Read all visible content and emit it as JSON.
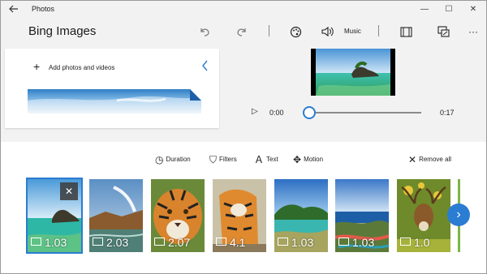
{
  "titlebar": {
    "app_title": "Photos",
    "back_icon": "arrow-left-icon",
    "minimize": "—",
    "maximize": "☐",
    "close": "✕"
  },
  "header": {
    "project_title": "Bing Images",
    "undo_icon": "undo-icon",
    "redo_icon": "redo-icon",
    "filter_icon": "palette-icon",
    "music_icon": "speaker-icon",
    "music_label": "Music",
    "aspect_icon": "aspect-ratio-icon",
    "export_icon": "export-icon",
    "more_label": "···"
  },
  "library": {
    "add_label": "Add photos and videos",
    "plus": "+",
    "collapse_icon": "chevron-left-icon"
  },
  "player": {
    "play_icon": "▷",
    "current_time": "0:00",
    "end_time": "0:17",
    "progress": 0.0
  },
  "storyboard": {
    "tools": [
      {
        "icon": "clock-icon",
        "glyph": "◷",
        "label": "Duration"
      },
      {
        "icon": "filter-icon",
        "glyph": "⛉",
        "label": "Filters"
      },
      {
        "icon": "text-icon",
        "glyph": "Ａ",
        "label": "Text"
      },
      {
        "icon": "motion-icon",
        "glyph": "✥",
        "label": "Motion"
      }
    ],
    "remove_all": {
      "icon": "close-icon",
      "glyph": "✕",
      "label": "Remove all"
    },
    "clips": [
      {
        "duration": "1.03",
        "scene": "lagoon",
        "selected": true
      },
      {
        "duration": "2.03",
        "scene": "waterfall",
        "selected": false
      },
      {
        "duration": "2.07",
        "scene": "tiger-face",
        "selected": false
      },
      {
        "duration": "4.1",
        "scene": "tiger-standing",
        "selected": false
      },
      {
        "duration": "1.03",
        "scene": "reef-island",
        "selected": false
      },
      {
        "duration": "1.03",
        "scene": "coast",
        "selected": false
      },
      {
        "duration": "1.0",
        "scene": "deer",
        "selected": false
      }
    ],
    "remove_clip_glyph": "✕",
    "next_glyph": "›"
  },
  "colors": {
    "accent": "#2b7cd3"
  }
}
